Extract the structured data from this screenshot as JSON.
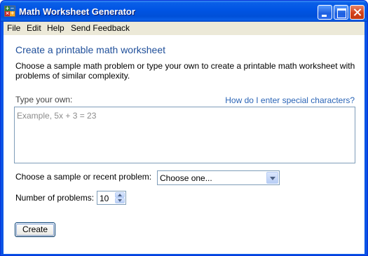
{
  "window": {
    "title": "Math Worksheet Generator",
    "icon": "math-app-icon",
    "icon_glyphs": [
      "+",
      "−",
      "×",
      "÷"
    ]
  },
  "menubar": {
    "items": [
      "File",
      "Edit",
      "Help",
      "Send Feedback"
    ]
  },
  "main": {
    "heading": "Create a printable math worksheet",
    "description": "Choose a sample math problem or type your own to create a printable math worksheet with problems of similar complexity.",
    "type_label": "Type your own:",
    "help_link": "How do I enter special characters?",
    "textarea_placeholder": "Example, 5x + 3 = 23",
    "sample_label": "Choose a sample or recent problem:",
    "sample_selected": "Choose one...",
    "count_label": "Number of problems:",
    "count_value": "10",
    "create_label": "Create"
  },
  "colors": {
    "titlebar": "#0054e3",
    "heading": "#1f4f9a",
    "link": "#2a64b6",
    "menubar": "#ece9d8"
  }
}
